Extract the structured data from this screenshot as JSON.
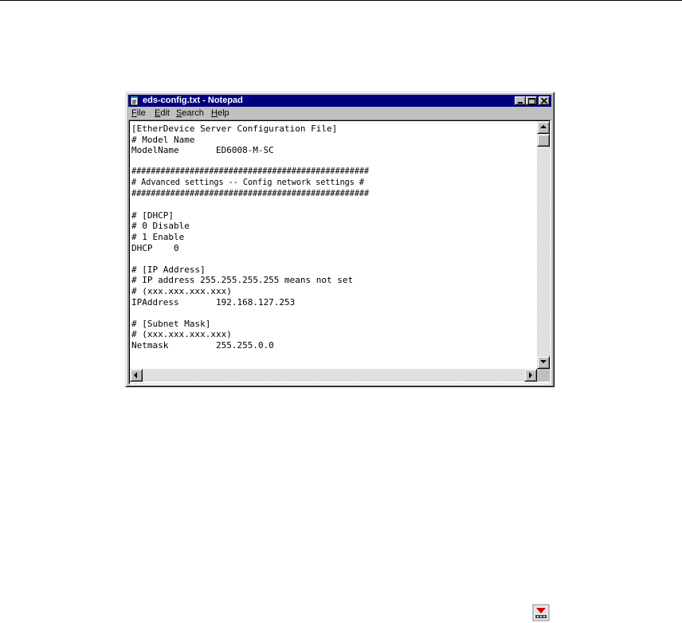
{
  "window": {
    "title": "eds-config.txt - Notepad",
    "title_icon": "notepad-icon",
    "controls": {
      "minimize_icon": "minimize-icon",
      "maximize_icon": "maximize-icon",
      "close_icon": "close-icon"
    }
  },
  "menu": {
    "file": {
      "accel": "F",
      "rest": "ile"
    },
    "edit": {
      "accel": "E",
      "rest": "dit"
    },
    "search": {
      "accel": "S",
      "rest": "earch"
    },
    "help": {
      "accel": "H",
      "rest": "elp"
    }
  },
  "editor": {
    "lines": [
      "[EtherDevice Server Configuration File]",
      "# Model Name",
      "ModelName       ED6008-M-SC",
      "",
      "#################################################",
      "# Advanced settings -- Config network settings #",
      "#################################################",
      "",
      "# [DHCP]",
      "# 0 Disable",
      "# 1 Enable",
      "DHCP    0",
      "",
      "# [IP Address]",
      "# IP address 255.255.255.255 means not set",
      "# (xxx.xxx.xxx.xxx)",
      "IPAddress       192.168.127.253",
      "",
      "# [Subnet Mask]",
      "# (xxx.xxx.xxx.xxx)",
      "Netmask         255.255.0.0"
    ]
  },
  "colors": {
    "titlebar": "#000080",
    "chrome": "#c0c0c0",
    "text": "#000000",
    "page_icon_accent": "#d40000"
  },
  "page_icons": {
    "bottom_right": "download-arrow-icon"
  }
}
